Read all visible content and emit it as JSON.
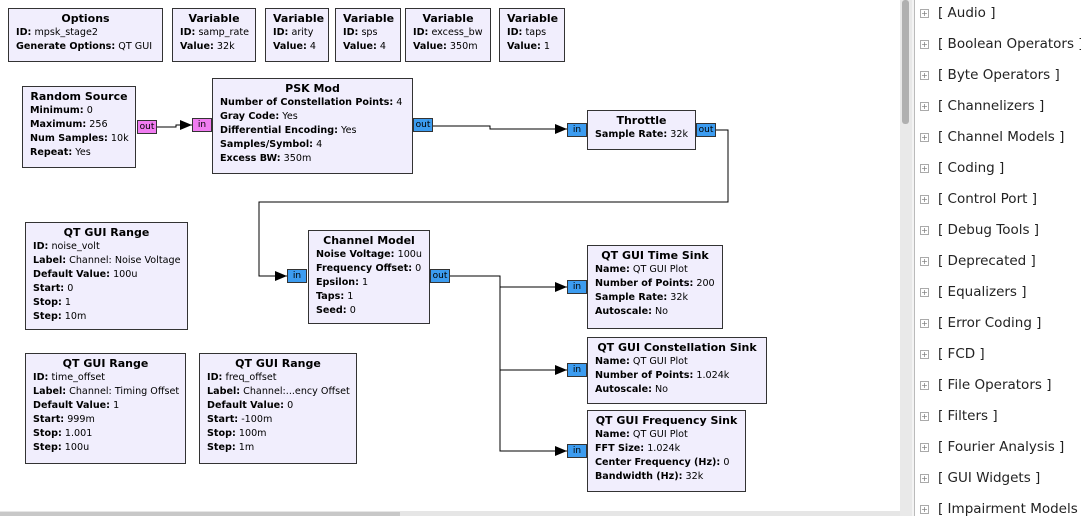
{
  "blocks": {
    "options": {
      "title": "Options",
      "p": [
        [
          "ID:",
          "mpsk_stage2"
        ],
        [
          "Generate Options:",
          "QT GUI"
        ]
      ]
    },
    "v1": {
      "title": "Variable",
      "p": [
        [
          "ID:",
          "samp_rate"
        ],
        [
          "Value:",
          "32k"
        ]
      ]
    },
    "v2": {
      "title": "Variable",
      "p": [
        [
          "ID:",
          "arity"
        ],
        [
          "Value:",
          "4"
        ]
      ]
    },
    "v3": {
      "title": "Variable",
      "p": [
        [
          "ID:",
          "sps"
        ],
        [
          "Value:",
          "4"
        ]
      ]
    },
    "v4": {
      "title": "Variable",
      "p": [
        [
          "ID:",
          "excess_bw"
        ],
        [
          "Value:",
          "350m"
        ]
      ]
    },
    "v5": {
      "title": "Variable",
      "p": [
        [
          "ID:",
          "taps"
        ],
        [
          "Value:",
          "1"
        ]
      ]
    },
    "rand": {
      "title": "Random Source",
      "p": [
        [
          "Minimum:",
          "0"
        ],
        [
          "Maximum:",
          "256"
        ],
        [
          "Num Samples:",
          "10k"
        ],
        [
          "Repeat:",
          "Yes"
        ]
      ]
    },
    "psk": {
      "title": "PSK Mod",
      "p": [
        [
          "Number of Constellation Points:",
          "4"
        ],
        [
          "Gray Code:",
          "Yes"
        ],
        [
          "Differential Encoding:",
          "Yes"
        ],
        [
          "Samples/Symbol:",
          "4"
        ],
        [
          "Excess BW:",
          "350m"
        ]
      ]
    },
    "thr": {
      "title": "Throttle",
      "p": [
        [
          "Sample Rate:",
          "32k"
        ]
      ]
    },
    "chan": {
      "title": "Channel Model",
      "p": [
        [
          "Noise Voltage:",
          "100u"
        ],
        [
          "Frequency Offset:",
          "0"
        ],
        [
          "Epsilon:",
          "1"
        ],
        [
          "Taps:",
          "1"
        ],
        [
          "Seed:",
          "0"
        ]
      ]
    },
    "r1": {
      "title": "QT GUI Range",
      "p": [
        [
          "ID:",
          "noise_volt"
        ],
        [
          "Label:",
          "Channel: Noise Voltage"
        ],
        [
          "Default Value:",
          "100u"
        ],
        [
          "Start:",
          "0"
        ],
        [
          "Stop:",
          "1"
        ],
        [
          "Step:",
          "10m"
        ]
      ]
    },
    "r2": {
      "title": "QT GUI Range",
      "p": [
        [
          "ID:",
          "time_offset"
        ],
        [
          "Label:",
          "Channel: Timing Offset"
        ],
        [
          "Default Value:",
          "1"
        ],
        [
          "Start:",
          "999m"
        ],
        [
          "Stop:",
          "1.001"
        ],
        [
          "Step:",
          "100u"
        ]
      ]
    },
    "r3": {
      "title": "QT GUI Range",
      "p": [
        [
          "ID:",
          "freq_offset"
        ],
        [
          "Label:",
          "Channel:...ency Offset"
        ],
        [
          "Default Value:",
          "0"
        ],
        [
          "Start:",
          "-100m"
        ],
        [
          "Stop:",
          "100m"
        ],
        [
          "Step:",
          "1m"
        ]
      ]
    },
    "ts": {
      "title": "QT GUI Time Sink",
      "p": [
        [
          "Name:",
          "QT GUI Plot"
        ],
        [
          "Number of Points:",
          "200"
        ],
        [
          "Sample Rate:",
          "32k"
        ],
        [
          "Autoscale:",
          "No"
        ]
      ]
    },
    "cs": {
      "title": "QT GUI Constellation Sink",
      "p": [
        [
          "Name:",
          "QT GUI Plot"
        ],
        [
          "Number of Points:",
          "1.024k"
        ],
        [
          "Autoscale:",
          "No"
        ]
      ]
    },
    "fs": {
      "title": "QT GUI Frequency Sink",
      "p": [
        [
          "Name:",
          "QT GUI Plot"
        ],
        [
          "FFT Size:",
          "1.024k"
        ],
        [
          "Center Frequency (Hz):",
          "0"
        ],
        [
          "Bandwidth (Hz):",
          "32k"
        ]
      ]
    }
  },
  "ports": {
    "in": "in",
    "out": "out"
  },
  "port_colors": {
    "byte": "#f07cf0",
    "complex": "#3c9cf0"
  },
  "tree": {
    "expander": "+",
    "items": [
      "[ Audio ]",
      "[ Boolean Operators ]",
      "[ Byte Operators ]",
      "[ Channelizers ]",
      "[ Channel Models ]",
      "[ Coding ]",
      "[ Control Port ]",
      "[ Debug Tools ]",
      "[ Deprecated ]",
      "[ Equalizers ]",
      "[ Error Coding ]",
      "[ FCD ]",
      "[ File Operators ]",
      "[ Filters ]",
      "[ Fourier Analysis ]",
      "[ GUI Widgets ]",
      "[ Impairment Models ]"
    ]
  }
}
